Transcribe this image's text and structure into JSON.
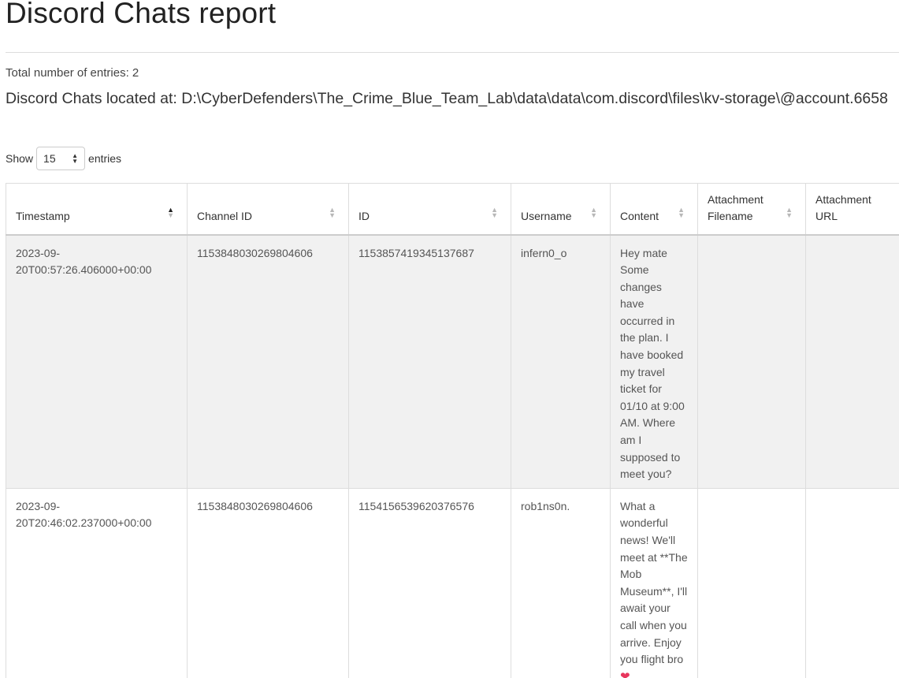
{
  "page": {
    "title": "Discord Chats report",
    "total_entries": "Total number of entries: 2",
    "location": "Discord Chats located at: D:\\CyberDefenders\\The_Crime_Blue_Team_Lab\\data\\data\\com.discord\\files\\kv-storage\\@account.6658"
  },
  "length_menu": {
    "show_label": "Show",
    "selected": "15",
    "entries_label": "entries"
  },
  "table": {
    "columns": [
      {
        "label": "Timestamp",
        "sorted": "ascending"
      },
      {
        "label": "Channel ID",
        "sorted": "none"
      },
      {
        "label": "ID",
        "sorted": "none"
      },
      {
        "label": "Username",
        "sorted": "none"
      },
      {
        "label": "Content",
        "sorted": "none"
      },
      {
        "label": "Attachment Filename",
        "sorted": "none"
      },
      {
        "label": "Attachment URL",
        "sorted": "none"
      }
    ],
    "rows": [
      {
        "timestamp": "2023-09-20T00:57:26.406000+00:00",
        "channel_id": "1153848030269804606",
        "id": "1153857419345137687",
        "username": "infern0_o",
        "content": "Hey mate Some changes have occurred in the plan. I have booked my travel ticket for 01/10 at 9:00 AM. Where am I supposed to meet you?",
        "attachment_filename": "",
        "attachment_url": ""
      },
      {
        "timestamp": "2023-09-20T20:46:02.237000+00:00",
        "channel_id": "1153848030269804606",
        "id": "1154156539620376576",
        "username": "rob1ns0n.",
        "content": "What a wonderful news! We'll meet at **The Mob Museum**, I'll await your call when you arrive. Enjoy you flight bro",
        "content_emoji": "❤",
        "attachment_filename": "",
        "attachment_url": ""
      }
    ]
  },
  "colors": {
    "row_odd_bg": "#f1f1f1",
    "row_even_bg": "#ffffff",
    "border": "#dddddd",
    "heart": "#e8365d"
  },
  "icons": {
    "sort": "sort-arrows-icon",
    "select": "select-arrows-icon",
    "emoji": "heart-emoji-icon"
  }
}
